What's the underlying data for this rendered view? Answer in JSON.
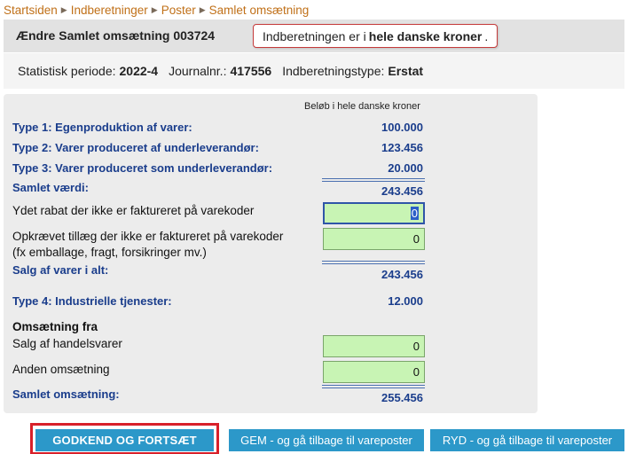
{
  "breadcrumb": {
    "items": [
      "Startsiden",
      "Indberetninger",
      "Poster",
      "Samlet omsætning"
    ]
  },
  "header": {
    "title": "Ændre Samlet omsætning 003724",
    "notice_pre": "Indberetningen er i",
    "notice_bold": "hele danske kroner",
    "notice_post": "."
  },
  "info": {
    "period_label": "Statistisk periode:",
    "period_value": "2022-4",
    "journal_label": "Journalnr.:",
    "journal_value": "417556",
    "type_label": "Indberetningstype:",
    "type_value": "Erstat"
  },
  "form": {
    "unit_note": "Beløb i hele danske kroner",
    "type1_label": "Type 1: Egenproduktion af varer:",
    "type1_value": "100.000",
    "type2_label": "Type 2: Varer produceret af underleverandør:",
    "type2_value": "123.456",
    "type3_label": "Type 3: Varer produceret som underleverandør:",
    "type3_value": "20.000",
    "samlet_vaerdi_label": "Samlet værdi:",
    "samlet_vaerdi_value": "243.456",
    "rabat_label": "Ydet rabat der ikke er faktureret på varekoder",
    "rabat_value": "0",
    "tillaeg_label_line1": "Opkrævet tillæg der ikke er faktureret på varekoder",
    "tillaeg_label_line2": "(fx emballage, fragt, forsikringer mv.)",
    "tillaeg_value": "0",
    "salg_label": "Salg af varer i alt:",
    "salg_value": "243.456",
    "type4_label": "Type 4: Industrielle tjenester:",
    "type4_value": "12.000",
    "omsaetning_heading": "Omsætning fra",
    "handelsvarer_label": "Salg af handelsvarer",
    "handelsvarer_value": "0",
    "anden_label": "Anden omsætning",
    "anden_value": "0",
    "samlet_oms_label": "Samlet omsætning:",
    "samlet_oms_value": "255.456"
  },
  "buttons": {
    "approve": "GODKEND OG FORTSÆT",
    "save": "GEM - og gå tilbage til vareposter",
    "clear": "RYD - og gå tilbage til vareposter"
  },
  "colors": {
    "link": "#c07018",
    "label_blue": "#1a3d8c",
    "field_green": "#c8f4b4",
    "button_blue": "#2c98c9",
    "highlight_red": "#d8202a"
  }
}
